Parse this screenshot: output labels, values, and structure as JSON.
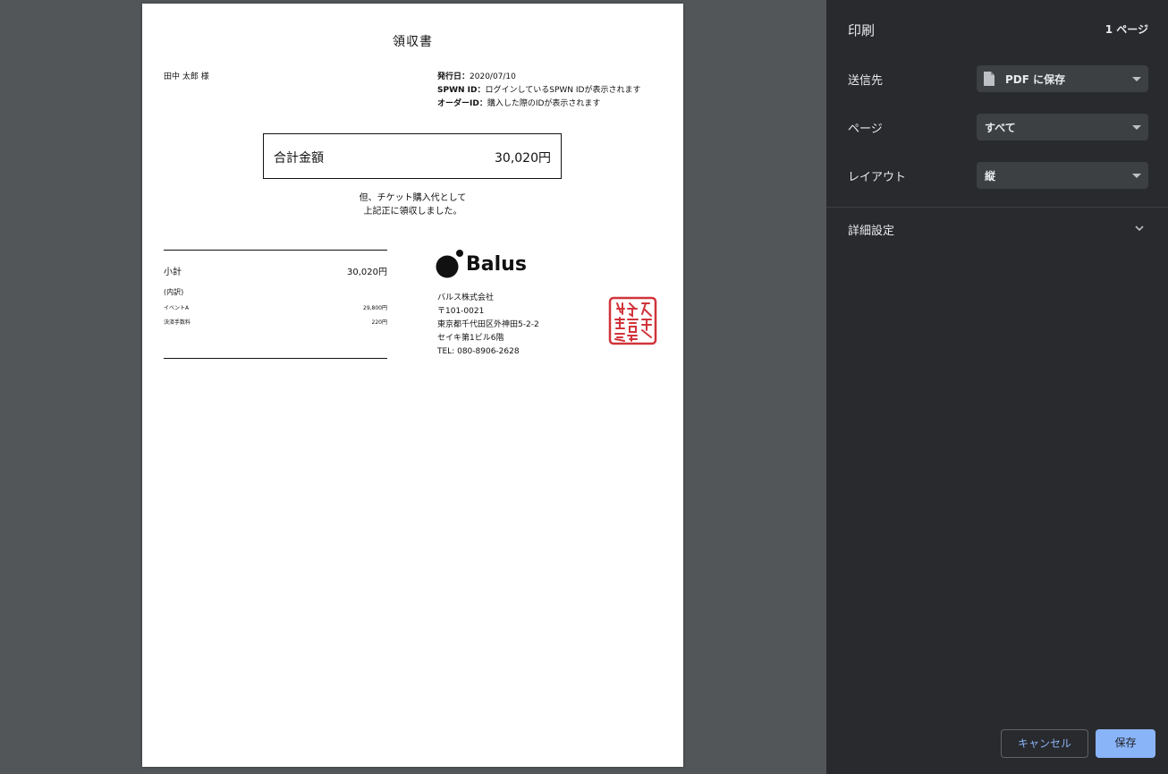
{
  "receipt": {
    "title": "領収書",
    "recipient": "田中 太郎 様",
    "meta": {
      "issue_date_label": "発行日：",
      "issue_date": "2020/07/10",
      "spwn_id_label": "SPWN ID：",
      "spwn_id": "ログインしているSPWN IDが表示されます",
      "order_id_label": "オーダーID：",
      "order_id": "購入した際のIDが表示されます"
    },
    "total_label": "合計金額",
    "total_value": "30,020円",
    "note_line1": "但、チケット購入代として",
    "note_line2": "上記正に領収しました。",
    "subtotal_label": "小計",
    "subtotal_value": "30,020円",
    "breakdown_label": "(内訳)",
    "breakdown": [
      {
        "name": "イベントA",
        "value": "29,800円"
      },
      {
        "name": "決済手数料",
        "value": "220円"
      }
    ],
    "company": {
      "logo_text": "Balus",
      "name": "バルス株式会社",
      "postal": "〒101-0021",
      "address1": "東京都千代田区外神田5-2-2",
      "address2": "セイキ第1ビル6階",
      "tel": "TEL: 080-8906-2628"
    },
    "seal_color": "#d0343a"
  },
  "print_panel": {
    "title": "印刷",
    "page_count": "1 ページ",
    "destination_label": "送信先",
    "destination_value": "PDF に保存",
    "pages_label": "ページ",
    "pages_value": "すべて",
    "layout_label": "レイアウト",
    "layout_value": "縦",
    "advanced_label": "詳細設定",
    "cancel_label": "キャンセル",
    "save_label": "保存",
    "accent_color": "#8ab4f8"
  }
}
